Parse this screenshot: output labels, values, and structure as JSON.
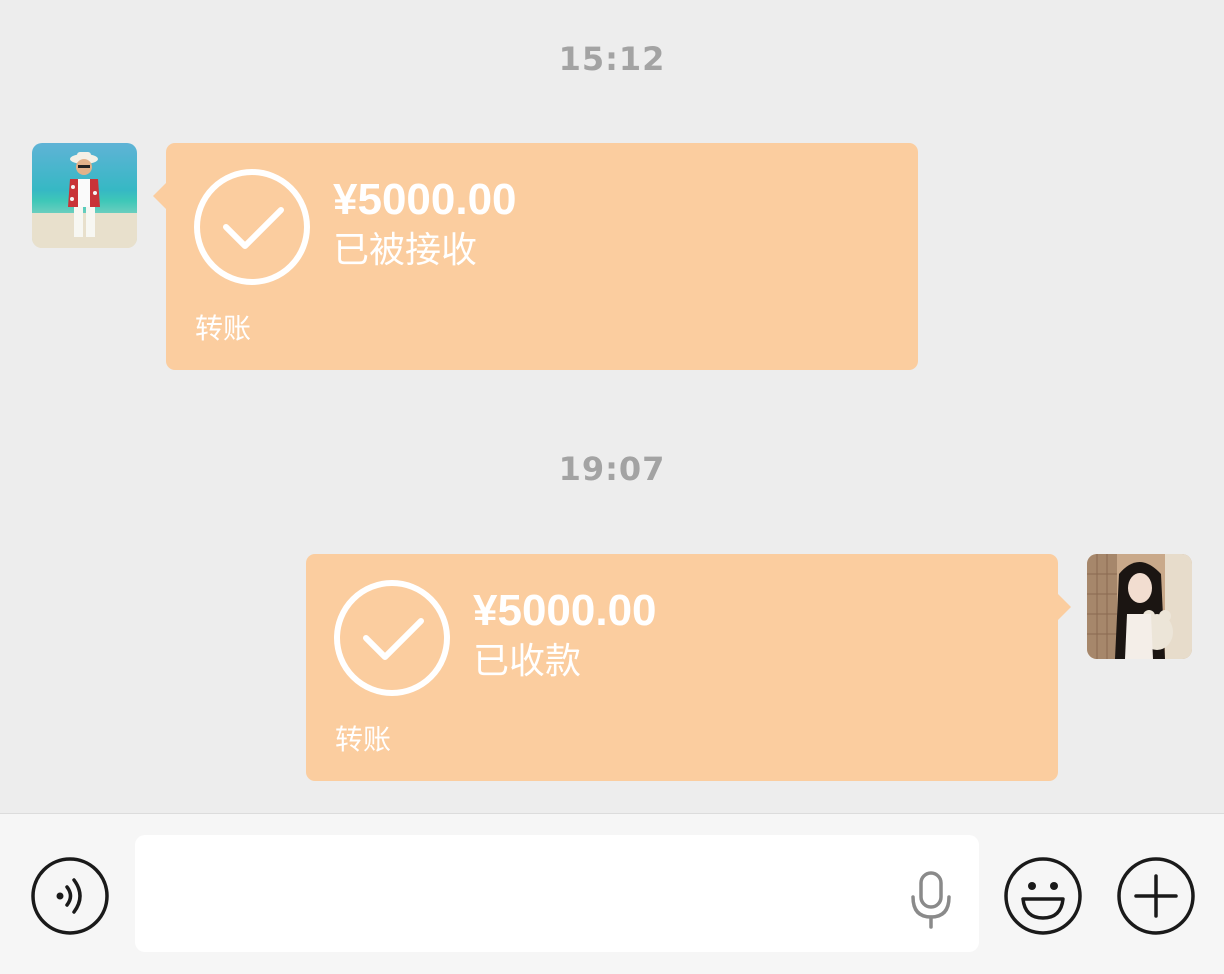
{
  "messages": [
    {
      "timestamp": "15:12",
      "side": "left",
      "avatar_icon": "boy-on-beach-avatar",
      "transfer": {
        "amount": "¥5000.00",
        "status": "已被接收",
        "kind": "转账"
      }
    },
    {
      "timestamp": "19:07",
      "side": "right",
      "avatar_icon": "girl-with-teddy-avatar",
      "transfer": {
        "amount": "¥5000.00",
        "status": "已收款",
        "kind": "转账"
      }
    }
  ],
  "input_bar": {
    "left_icon": "voice-icon",
    "field_icon": "microphone-icon",
    "emoji_icon": "smiley-icon",
    "plus_icon": "plus-icon"
  },
  "colors": {
    "background": "#ededed",
    "bubble": "#fbcd9f",
    "timestamp": "#a3a3a3",
    "icon_stroke": "#1a1a1a"
  }
}
